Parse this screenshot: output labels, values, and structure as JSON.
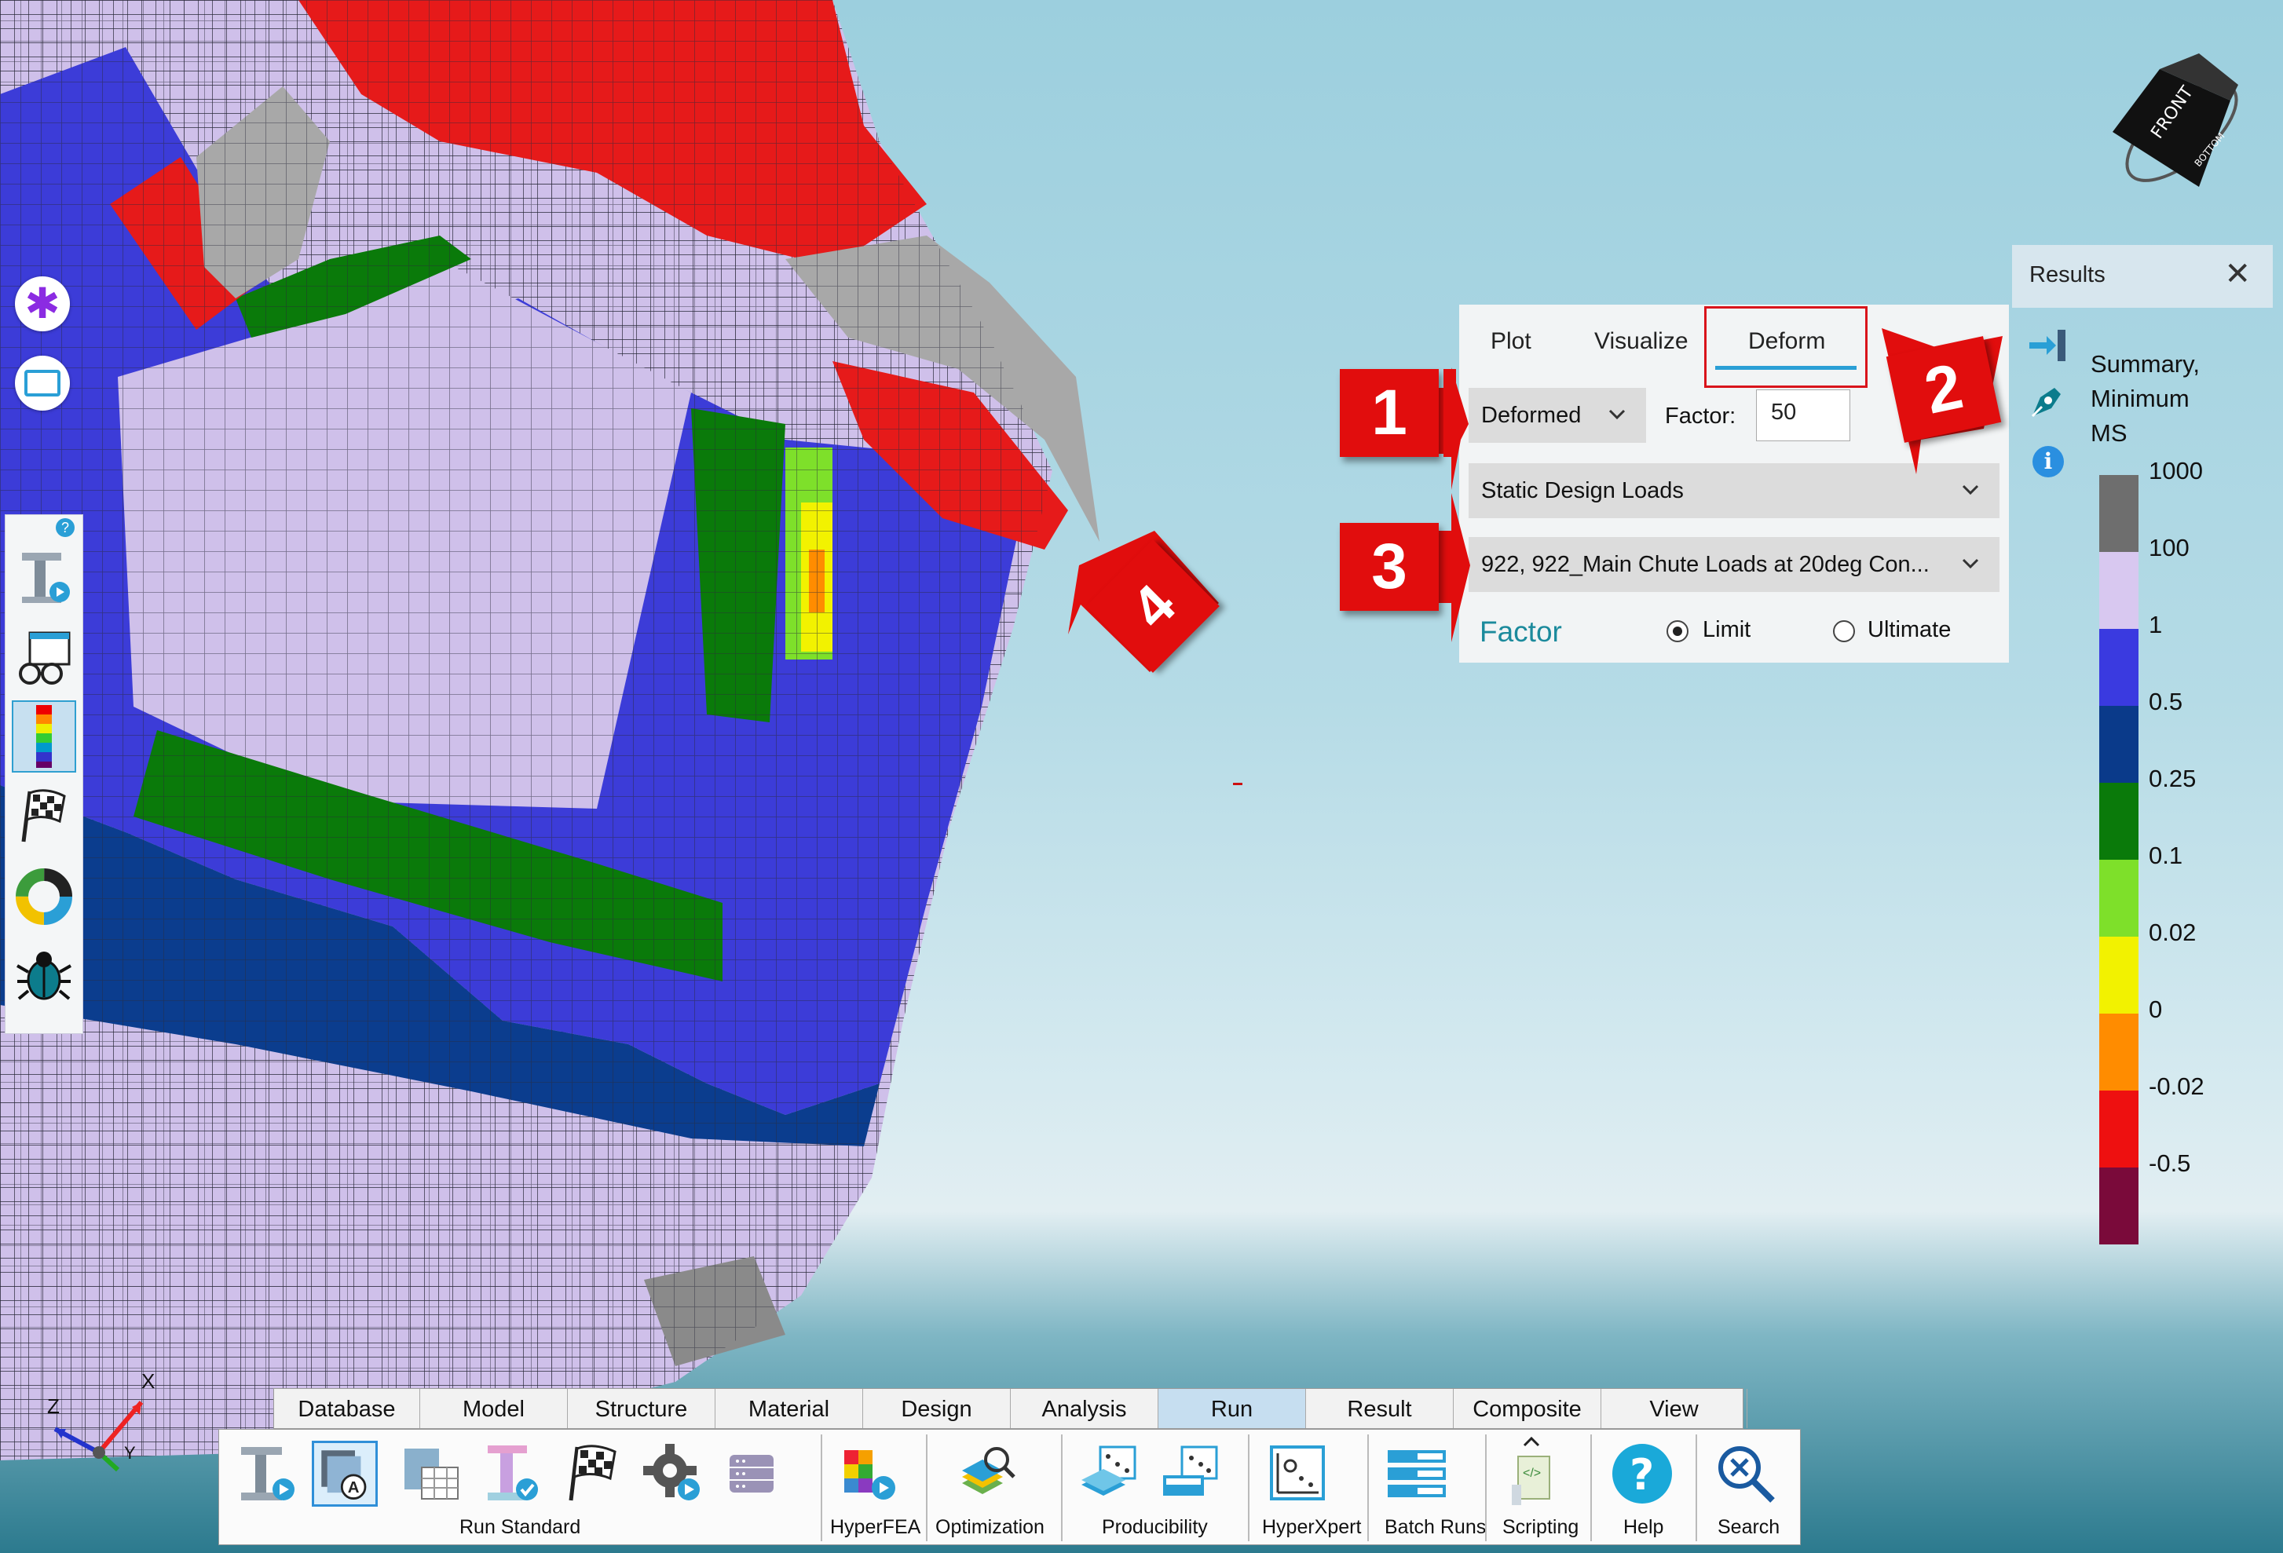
{
  "deform_panel": {
    "tabs": [
      "Plot",
      "Visualize",
      "Deform"
    ],
    "active_tab": "Deform",
    "mode_dropdown": "Deformed",
    "factor_label": "Factor:",
    "factor_value": "50",
    "load_set_dropdown": "Static Design Loads",
    "load_case_dropdown": "922, 922_Main Chute Loads at 20deg Con...",
    "factor_section_label": "Factor",
    "radio_limit": "Limit",
    "radio_ultimate": "Ultimate",
    "selected_radio": "Limit"
  },
  "results_panel": {
    "title": "Results",
    "summary_line1": "Summary,",
    "summary_line2": "Minimum",
    "summary_line3": "MS",
    "legend_labels": [
      "1000",
      "100",
      "1",
      "0.5",
      "0.25",
      "0.1",
      "0.02",
      "0",
      "-0.02",
      "-0.5"
    ],
    "legend_colors": [
      "#6e6e6e",
      "#d8c8f0",
      "#3a3ae0",
      "#0a3a8a",
      "#0a7a0a",
      "#7ee02a",
      "#f2f200",
      "#ff8c00",
      "#ee1010",
      "#7a0a3a"
    ]
  },
  "callouts": [
    "1",
    "2",
    "3",
    "4"
  ],
  "axis_labels": {
    "x": "X",
    "y": "Y",
    "z": "Z"
  },
  "view_cube": {
    "front": "FRONT",
    "bottom": "BOTTOM"
  },
  "ribbon": {
    "tabs": [
      "Database",
      "Model",
      "Structure",
      "Material",
      "Design",
      "Analysis",
      "Run",
      "Result",
      "Composite",
      "View"
    ],
    "active_tab": "Run",
    "groups": {
      "run_standard": "Run Standard",
      "hyperfea": "HyperFEA",
      "optimization": "Optimization",
      "producibility": "Producibility",
      "hyperxpert": "HyperXpert",
      "batch_runs": "Batch Runs",
      "scripting": "Scripting",
      "help": "Help",
      "search": "Search"
    }
  },
  "icons": [
    "star-icon",
    "rectangle-icon",
    "help-badge-icon",
    "analysis-tool-icon",
    "viewer-icon",
    "contour-icon",
    "checkered-flag-icon",
    "donut-chart-icon",
    "bug-icon",
    "pin-icon",
    "pen-icon",
    "info-icon",
    "close-icon"
  ]
}
